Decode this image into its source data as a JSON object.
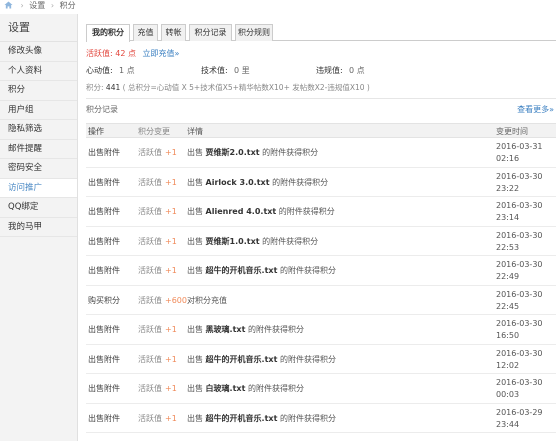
{
  "breadcrumb": {
    "items": [
      "设置",
      "积分"
    ]
  },
  "sidebar": {
    "title": "设置",
    "items": [
      "修改头像",
      "个人资料",
      "积分",
      "用户组",
      "隐私筛选",
      "邮件提醒",
      "密码安全",
      "访问推广",
      "QQ绑定",
      "我的马甲"
    ],
    "active_index": 7
  },
  "tabs": [
    "我的积分",
    "充值",
    "转帐",
    "积分记录",
    "积分规则"
  ],
  "summary": {
    "activity_label": "活跃值:",
    "activity_value": "42 点",
    "recharge_link": "立即充值»",
    "heart_label": "心动值:",
    "heart_value": "1 点",
    "tech_label": "技术值:",
    "tech_value": "0 里",
    "violation_label": "违规值:",
    "violation_value": "0 点",
    "points_label": "积分:",
    "points_value": "441",
    "points_formula": "( 总积分=心动值 X 5+技术值X5+精华帖数X10+ 发帖数X2-违规值X10 )"
  },
  "records": {
    "title": "积分记录",
    "more": "查看更多»",
    "columns": [
      "操作",
      "积分变更",
      "详情",
      "变更时间"
    ],
    "rows": [
      {
        "op": "出售附件",
        "chg_label": "活跃值",
        "chg_value": "+1",
        "pre": "出售",
        "item": "贾维斯2.0.txt",
        "post": "的附件获得积分",
        "date": "2016-03-31",
        "time": "02:16"
      },
      {
        "op": "出售附件",
        "chg_label": "活跃值",
        "chg_value": "+1",
        "pre": "出售",
        "item": "Airlock 3.0.txt",
        "post": "的附件获得积分",
        "date": "2016-03-30",
        "time": "23:22"
      },
      {
        "op": "出售附件",
        "chg_label": "活跃值",
        "chg_value": "+1",
        "pre": "出售",
        "item": "Alienred 4.0.txt",
        "post": "的附件获得积分",
        "date": "2016-03-30",
        "time": "23:14"
      },
      {
        "op": "出售附件",
        "chg_label": "活跃值",
        "chg_value": "+1",
        "pre": "出售",
        "item": "贾维斯1.0.txt",
        "post": "的附件获得积分",
        "date": "2016-03-30",
        "time": "22:53"
      },
      {
        "op": "出售附件",
        "chg_label": "活跃值",
        "chg_value": "+1",
        "pre": "出售",
        "item": "超牛的开机音乐.txt",
        "post": "的附件获得积分",
        "date": "2016-03-30",
        "time": "22:49"
      },
      {
        "op": "购买积分",
        "chg_label": "活跃值",
        "chg_value": "+600",
        "pre": "",
        "item": "",
        "post": "对积分充值",
        "date": "2016-03-30",
        "time": "22:45"
      },
      {
        "op": "出售附件",
        "chg_label": "活跃值",
        "chg_value": "+1",
        "pre": "出售",
        "item": "黑玻璃.txt",
        "post": "的附件获得积分",
        "date": "2016-03-30",
        "time": "16:50"
      },
      {
        "op": "出售附件",
        "chg_label": "活跃值",
        "chg_value": "+1",
        "pre": "出售",
        "item": "超牛的开机音乐.txt",
        "post": "的附件获得积分",
        "date": "2016-03-30",
        "time": "12:02"
      },
      {
        "op": "出售附件",
        "chg_label": "活跃值",
        "chg_value": "+1",
        "pre": "出售",
        "item": "白玻璃.txt",
        "post": "的附件获得积分",
        "date": "2016-03-30",
        "time": "00:03"
      },
      {
        "op": "出售附件",
        "chg_label": "活跃值",
        "chg_value": "+1",
        "pre": "出售",
        "item": "超牛的开机音乐.txt",
        "post": "的附件获得积分",
        "date": "2016-03-29",
        "time": "23:44"
      }
    ]
  },
  "colors": {
    "accent": "#3a7fc1",
    "hot": "#e2463c",
    "plus": "#f08a59"
  }
}
